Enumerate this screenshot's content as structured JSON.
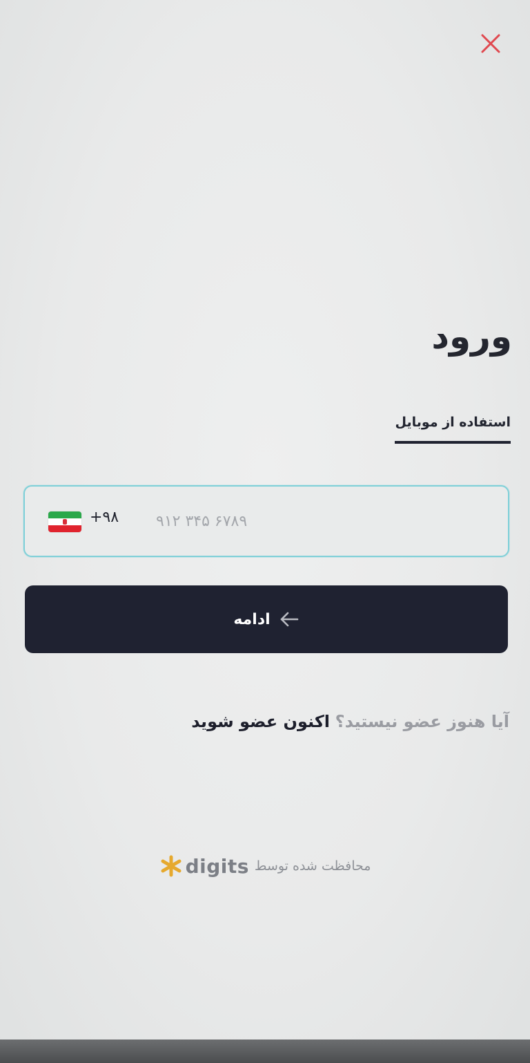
{
  "login": {
    "title": "ورود",
    "tab_label": "استفاده از موبایل",
    "country_code": "+۹۸",
    "phone_placeholder": "۹۱۲ ۳۴۵ ۶۷۸۹",
    "continue_label": "ادامه",
    "signup_question": "آیا هنوز عضو نیستید؟",
    "signup_link": "اکنون عضو شوید"
  },
  "footer": {
    "protected_by": "محافظت شده توسط",
    "brand": "digits"
  },
  "colors": {
    "primary": "#1f2231",
    "close": "#e0484f",
    "input_border": "#7fd0d8",
    "brand_star": "#e6a92e"
  },
  "icons": {
    "close": "close-icon",
    "arrow": "arrow-left-icon",
    "flag": "iran-flag-icon",
    "brand": "star-icon"
  }
}
